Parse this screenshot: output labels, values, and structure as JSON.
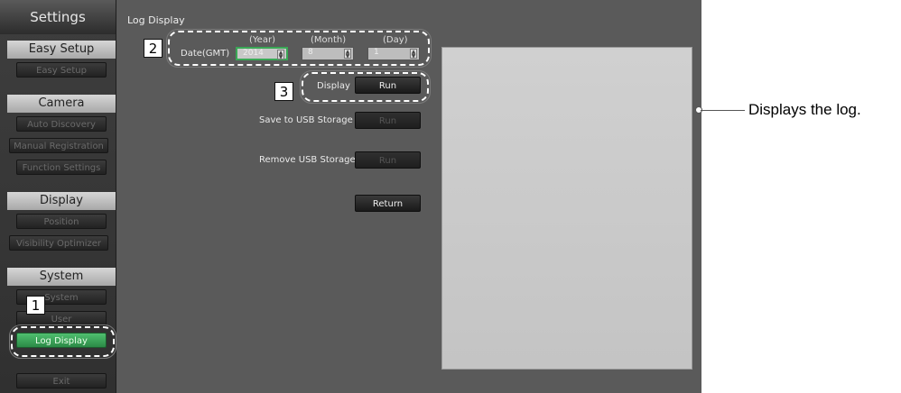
{
  "sidebar": {
    "title": "Settings",
    "sections": [
      {
        "header": "Easy Setup",
        "items": [
          "Easy Setup"
        ]
      },
      {
        "header": "Camera",
        "items": [
          "Auto Discovery",
          "Manual Registration",
          "Function Settings"
        ]
      },
      {
        "header": "Display",
        "items": [
          "Position",
          "Visibility Optimizer"
        ]
      },
      {
        "header": "System",
        "items": [
          "System",
          "User",
          "Log Display"
        ]
      }
    ],
    "exit_label": "Exit",
    "active_item": "Log Display"
  },
  "main": {
    "title": "Log Display",
    "date": {
      "label": "Date(GMT)",
      "year_header": "(Year)",
      "month_header": "(Month)",
      "day_header": "(Day)",
      "year_value": "2014",
      "month_value": "8",
      "day_value": "1"
    },
    "display": {
      "label": "Display",
      "button": "Run"
    },
    "save_usb": {
      "label": "Save to USB Storage",
      "button": "Run"
    },
    "remove_usb": {
      "label": "Remove USB Storage",
      "button": "Run"
    },
    "return_button": "Return"
  },
  "annotations": {
    "markers": [
      "1",
      "2",
      "3"
    ],
    "callout": "Displays the log."
  },
  "colors": {
    "active_green": "#3aa856",
    "panel_bg": "#5a5a5a",
    "log_area": "#c8c8c8"
  }
}
